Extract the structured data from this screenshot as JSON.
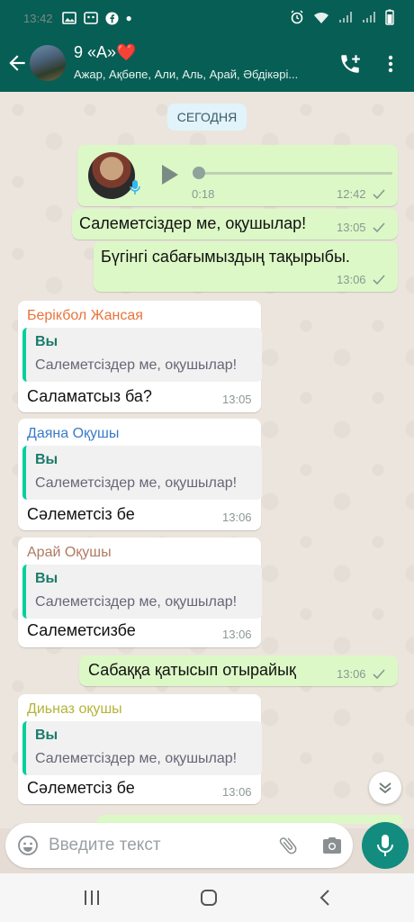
{
  "status_bar": {
    "time": "13:42"
  },
  "header": {
    "title": "9 «А»❤️",
    "subtitle": "Ажар, Ақбөпе, Али, Аль, Арай, Әбдікәрі..."
  },
  "chat": {
    "date_chip": "СЕГОДНЯ",
    "voice": {
      "duration": "0:18",
      "time": "12:42"
    },
    "outgoing": [
      {
        "text": "Салеметсіздер ме, оқушылар!",
        "time": "13:05"
      },
      {
        "text": "Бүгінгі сабағымыздың тақырыбы.",
        "time": "13:06"
      },
      {
        "text": "Сабаққа қатысып отырайық",
        "time": "13:06"
      }
    ],
    "incoming": [
      {
        "sender": "Берікбол Жансая",
        "sender_color": "#e8743b",
        "quote_author": "Вы",
        "quote_text": "Салеметсіздер ме, оқушылар!",
        "text": "Саламатсыз ба?",
        "time": "13:05"
      },
      {
        "sender": "Даяна Оқушы",
        "sender_color": "#3a7bc8",
        "quote_author": "Вы",
        "quote_text": "Салеметсіздер ме, оқушылар!",
        "text": "Сәлеметсіз бе",
        "time": "13:06"
      },
      {
        "sender": "Арай Оқушы",
        "sender_color": "#b07a62",
        "quote_author": "Вы",
        "quote_text": "Салеметсіздер ме, оқушылар!",
        "text": "Салеметсизбе",
        "time": "13:06"
      },
      {
        "sender": "Диьназ оқушы",
        "sender_color": "#b5b33a",
        "quote_author": "Вы",
        "quote_text": "Салеметсіздер ме, оқушылар!",
        "text": "Сәлеметсіз бе",
        "time": "13:06"
      }
    ]
  },
  "input": {
    "placeholder": "Введите текст"
  },
  "colors": {
    "header": "#075e54",
    "outgoing_bubble": "#dcf8c6",
    "accent": "#128c7e"
  }
}
